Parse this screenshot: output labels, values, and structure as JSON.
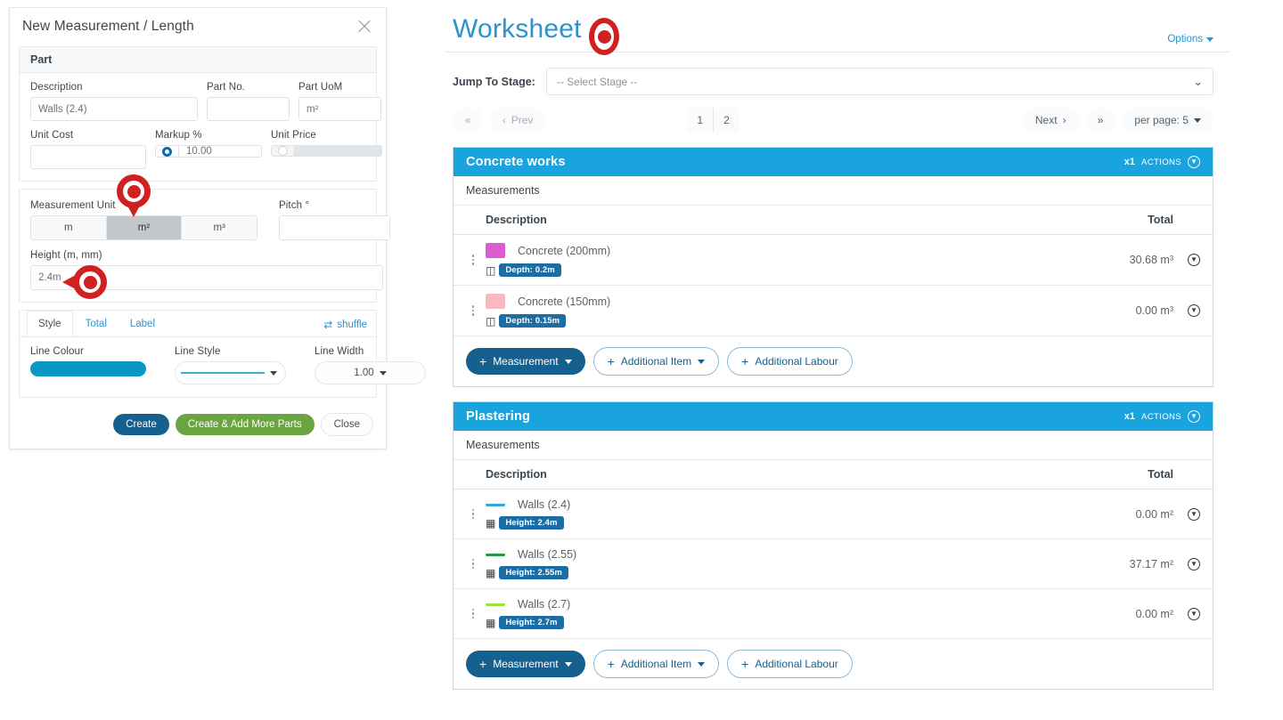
{
  "dialog": {
    "title": "New Measurement / Length",
    "close_icon": "close-icon",
    "part_section": {
      "heading": "Part",
      "description_label": "Description",
      "description_value": "Walls (2.4)",
      "part_no_label": "Part No.",
      "part_no_value": "",
      "part_uom_label": "Part UoM",
      "part_uom_value": "m²",
      "unit_cost_label": "Unit Cost",
      "unit_cost_value": "",
      "markup_label": "Markup %",
      "markup_value": "10.00",
      "unit_price_label": "Unit Price",
      "unit_price_value": ""
    },
    "unit_section": {
      "measurement_unit_label": "Measurement Unit",
      "units": [
        "m",
        "m²",
        "m³"
      ],
      "selected_unit": "m²",
      "pitch_label": "Pitch °",
      "pitch_value": "",
      "height_label": "Height (m, mm)",
      "height_value": "2.4m"
    },
    "style_section": {
      "tabs": [
        "Style",
        "Total",
        "Label"
      ],
      "active_tab": "Style",
      "shuffle_label": "shuffle",
      "shuffle_icon": "shuffle-icon",
      "line_colour_label": "Line Colour",
      "line_colour_value": "#0b97c4",
      "line_style_label": "Line Style",
      "line_width_label": "Line Width",
      "line_width_value": "1.00"
    },
    "footer": {
      "create_label": "Create",
      "create_add_more_label": "Create & Add More Parts",
      "close_label": "Close"
    }
  },
  "worksheet": {
    "title": "Worksheet",
    "options_label": "Options",
    "jump_to_stage_label": "Jump To Stage:",
    "jump_to_stage_value": "-- Select Stage --",
    "pager": {
      "first_icon": "«",
      "prev_label": "Prev",
      "pages": [
        "1",
        "2"
      ],
      "active_page": "1",
      "next_label": "Next",
      "last_icon": "»",
      "per_page_label": "per page: 5"
    },
    "columns": {
      "description": "Description",
      "total": "Total"
    },
    "measurements_label": "Measurements",
    "actions_label": "ACTIONS",
    "multiplier_label": "x1",
    "add_buttons": {
      "measurement": "Measurement",
      "additional_item": "Additional Item",
      "additional_labour": "Additional Labour"
    },
    "sections": [
      {
        "title": "Concrete works",
        "rows": [
          {
            "swatch_type": "block",
            "color": "#dd5bd0",
            "name": "Concrete (200mm)",
            "tag_icon": "cube-icon",
            "tag": "Depth: 0.2m",
            "total": "30.68 m³"
          },
          {
            "swatch_type": "block",
            "color": "#f9b9c2",
            "name": "Concrete (150mm)",
            "tag_icon": "cube-icon",
            "tag": "Depth: 0.15m",
            "total": "0.00 m³"
          }
        ]
      },
      {
        "title": "Plastering",
        "rows": [
          {
            "swatch_type": "line",
            "color": "#2fa8d5",
            "name": "Walls (2.4)",
            "tag_icon": "wall-icon",
            "tag": "Height: 2.4m",
            "total": "0.00 m²"
          },
          {
            "swatch_type": "line",
            "color": "#1f9c3d",
            "name": "Walls (2.55)",
            "tag_icon": "wall-icon",
            "tag": "Height: 2.55m",
            "total": "37.17 m²"
          },
          {
            "swatch_type": "line",
            "color": "#9ae23c",
            "name": "Walls (2.7)",
            "tag_icon": "wall-icon",
            "tag": "Height: 2.7m",
            "total": "0.00 m²"
          }
        ]
      }
    ]
  },
  "colors": {
    "accent_blue": "#19a4dd",
    "link_blue": "#2a93d0",
    "dark_blue": "#15608f",
    "green": "#6aa542",
    "marker_red": "#d0201f"
  }
}
